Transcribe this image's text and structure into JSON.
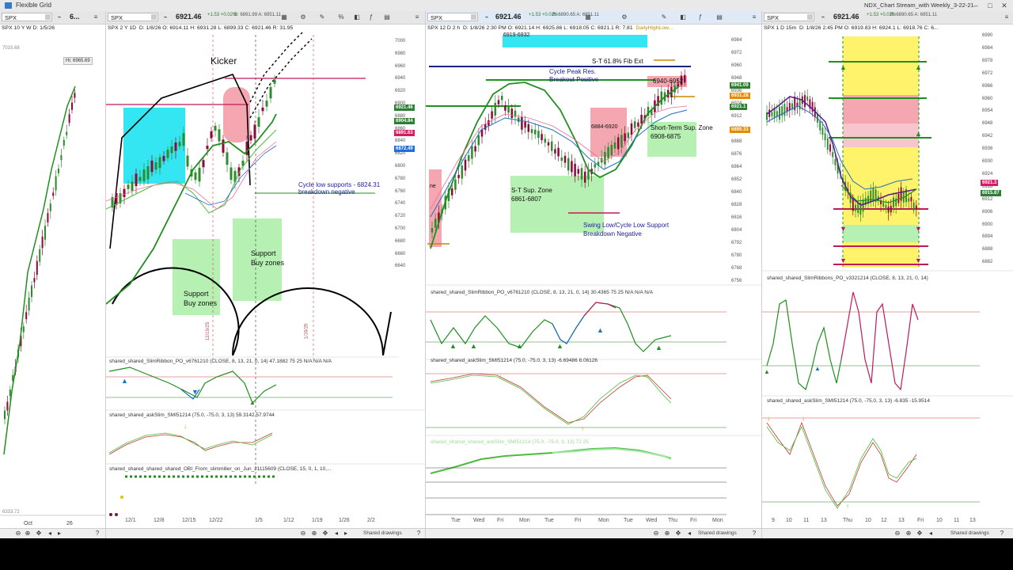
{
  "window": {
    "app_name": "Flexible Grid",
    "title": "NDX_Chart Stream_with Weekly_3-22-21"
  },
  "panels": [
    {
      "symbol": "SPX",
      "price": "6...",
      "info": "SPX 10 Y W  D: 1/5/26",
      "price_axis": [
        "7015.68",
        "Hi: 6965.69",
        "6333.72"
      ],
      "dates": [
        "Oct",
        "26"
      ]
    },
    {
      "symbol": "SPX",
      "price": "6921.46",
      "change": "+1.53 +0.02%",
      "bid_ask": "B: 6891.99 A: 6951.11",
      "info_prefix": "SPX 2 Y 1D",
      "info": "D: 1/8/26  O: 6914.11  H: 6931.28  L: 6899.33  C: 6921.46  R: 31.95",
      "price_axis": [
        "7000",
        "6980",
        "6960",
        "6940",
        "6920",
        "6900",
        "6880",
        "6860",
        "6840",
        "6820",
        "6800",
        "6780",
        "6760",
        "6740",
        "6720",
        "6700",
        "6680",
        "6660",
        "6640"
      ],
      "price_tags": [
        {
          "value": "6921.46",
          "color": "#2e7d32"
        },
        {
          "value": "6904.84",
          "color": "#2e7d32"
        },
        {
          "value": "6891.63",
          "color": "#d81b60"
        },
        {
          "value": "6872.49",
          "color": "#1e6fd9"
        }
      ],
      "annotations": {
        "kicker": "Kicker",
        "cycle_low_line1": "Cycle low supports - 6824.31",
        "cycle_low_line2": "breakdown negative",
        "support1_line1": "Support",
        "support1_line2": "Buy zones",
        "support2_line1": "Support",
        "support2_line2": "Buy zones",
        "vertical_dates": [
          "12/19/25",
          "1/16/26"
        ]
      },
      "studies": [
        {
          "label": "shared_shared_SlimRibbon_PO_v6761210 (CLOSE, 8, 13, 21, 0, 14)  47.1882  75  25  N/A  N/A  N/A",
          "axis": [
            "100",
            "75",
            "47.1882",
            "0"
          ]
        },
        {
          "label": "shared_shared_askSlim_SMI51214 (75.0, -75.0, 3, 13)  59.3142  57.9744",
          "axis": [
            "100",
            "59.3142",
            "50",
            "0"
          ]
        },
        {
          "label": "shared_shared_shared_shared_OBI_From_slimmiller_on_Jun_21115609 (CLOSE, 15, 0, 1, 10,...",
          "axis": [
            "1",
            "0",
            "-1",
            "-2"
          ]
        }
      ],
      "dates": [
        "12/1",
        "12/8",
        "12/15",
        "12/22",
        "1/5",
        "1/12",
        "1/19",
        "1/26",
        "2/2"
      ],
      "shared_drawings": "Shared drawings"
    },
    {
      "symbol": "SPX",
      "price": "6921.46",
      "change": "+1.53 +0.02%",
      "bid_ask": "B: 6890.65 A: 6951.11",
      "info_prefix": "SPX 12 D 2 h",
      "info": "D: 1/8/26 2:30 PM  O: 6921.14  H: 6925.86  L: 6918.05  C: 6921.1  R: 7.81",
      "daily_high_low": "DailyHighLow...",
      "price_axis": [
        "6984",
        "6972",
        "6960",
        "6948",
        "6936",
        "6924",
        "6912",
        "6900",
        "6888",
        "6876",
        "6864",
        "6852",
        "6840",
        "6828",
        "6816",
        "6804",
        "6792",
        "6780",
        "6768",
        "6756"
      ],
      "price_tags": [
        {
          "value": "6941.09",
          "color": "#2e7d32"
        },
        {
          "value": "6931.28",
          "color": "#e68a00"
        },
        {
          "value": "6921.1",
          "color": "#2e7d32"
        },
        {
          "value": "6899.33",
          "color": "#e68a00"
        }
      ],
      "annotations": {
        "top_cyan": "6919-6932",
        "fib": "S-T 61.8% Fib Ext",
        "cycle_peak_line1": "Cycle Peak Res.",
        "cycle_peak_line2": "Breakout Positive",
        "zone_6940": "6940-6952",
        "zone_6884": "6884-6920",
        "st_sup_line1": "Short-Term Sup. Zone",
        "st_sup_line2": "6908-6875",
        "st_zone_line1": "S-T Sup. Zone",
        "st_zone_line2": "6861-6807",
        "swing_line1": "Swing Low/Cycle Low Support",
        "swing_line2": "Breakdown Negative",
        "left_ne": "ne"
      },
      "studies": [
        {
          "label": "shared_shared_SlimRibbon_PO_v6761210 (CLOSE, 8, 13, 21, 0, 14)  30.4365  75  25  N/A  N/A  N/A",
          "axis": [
            "100",
            "75",
            "30.4365",
            "0"
          ]
        },
        {
          "label": "shared_shared_askSlim_SMI51214 (75.0, -75.0, 3, 13)  -6.69486  8.06126",
          "axis": [
            "100",
            "75",
            "50",
            "-6.6949",
            "-50",
            "-75"
          ]
        },
        {
          "label": "shared_shared_shared_askSlim_SMI51214 (75.0, -75.0, 3, 13) 72  25",
          "axis": [
            "100",
            "72",
            "50",
            "0",
            "-50",
            "-100"
          ]
        }
      ],
      "dates": [
        "Tue",
        "Wed",
        "Fri",
        "Mon",
        "Tue",
        "Fri",
        "Mon",
        "Tue",
        "Wed",
        "Thu",
        "Fri",
        "Mon"
      ],
      "shared_drawings": "Shared drawings"
    },
    {
      "symbol": "SPX",
      "price": "6921.46",
      "change": "+1.53 +0.02%",
      "bid_ask": "B: 6890.65 A: 6951.11",
      "info_prefix": "SPX 1 D 15m",
      "info": "D: 1/8/26 2:45 PM  O: 6919.83  H: 6924.1  L: 6918.76  C: 6...",
      "price_axis": [
        "6990",
        "6984",
        "6978",
        "6972",
        "6966",
        "6960",
        "6954",
        "6948",
        "6942",
        "6936",
        "6930",
        "6924",
        "6918",
        "6912",
        "6906",
        "6900",
        "6894",
        "6888",
        "6882"
      ],
      "price_tags": [
        {
          "value": "6921.3",
          "color": "#d81b60"
        },
        {
          "value": "6915.87",
          "color": "#2e7d32"
        }
      ],
      "studies": [
        {
          "label": "shared_shared_SlimRibbons_PO_v3321214 (CLOSE, 8, 13, 21, 0, 14)",
          "axis": [
            "100",
            "75.6323",
            "50",
            "25",
            "0"
          ]
        },
        {
          "label": "shared_shared_askSlim_SMI51214 (75.0, -75.0, 3, 13)  -6.835  -15.9514",
          "axis": [
            "75",
            "50",
            "25",
            "0",
            "-6.835",
            "-50",
            "-75"
          ]
        }
      ],
      "dates": [
        "9",
        "10",
        "11",
        "13",
        "Thu",
        "10",
        "12",
        "13",
        "Fri",
        "10",
        "11",
        "13"
      ],
      "shared_drawings": "Shared drawings"
    }
  ],
  "colors": {
    "cyan_zone": "#33e6f2",
    "green_zone": "#b6f0b2",
    "pink_zone": "#f4a7b0",
    "yellow_zone": "#fff36b",
    "price_line_green": "#1f8f1f",
    "ema_green": "#4cbb3c",
    "ema_blue": "#1f6fbf",
    "candle_up": "#2e8b2e",
    "candle_down": "#8b0a3a"
  }
}
